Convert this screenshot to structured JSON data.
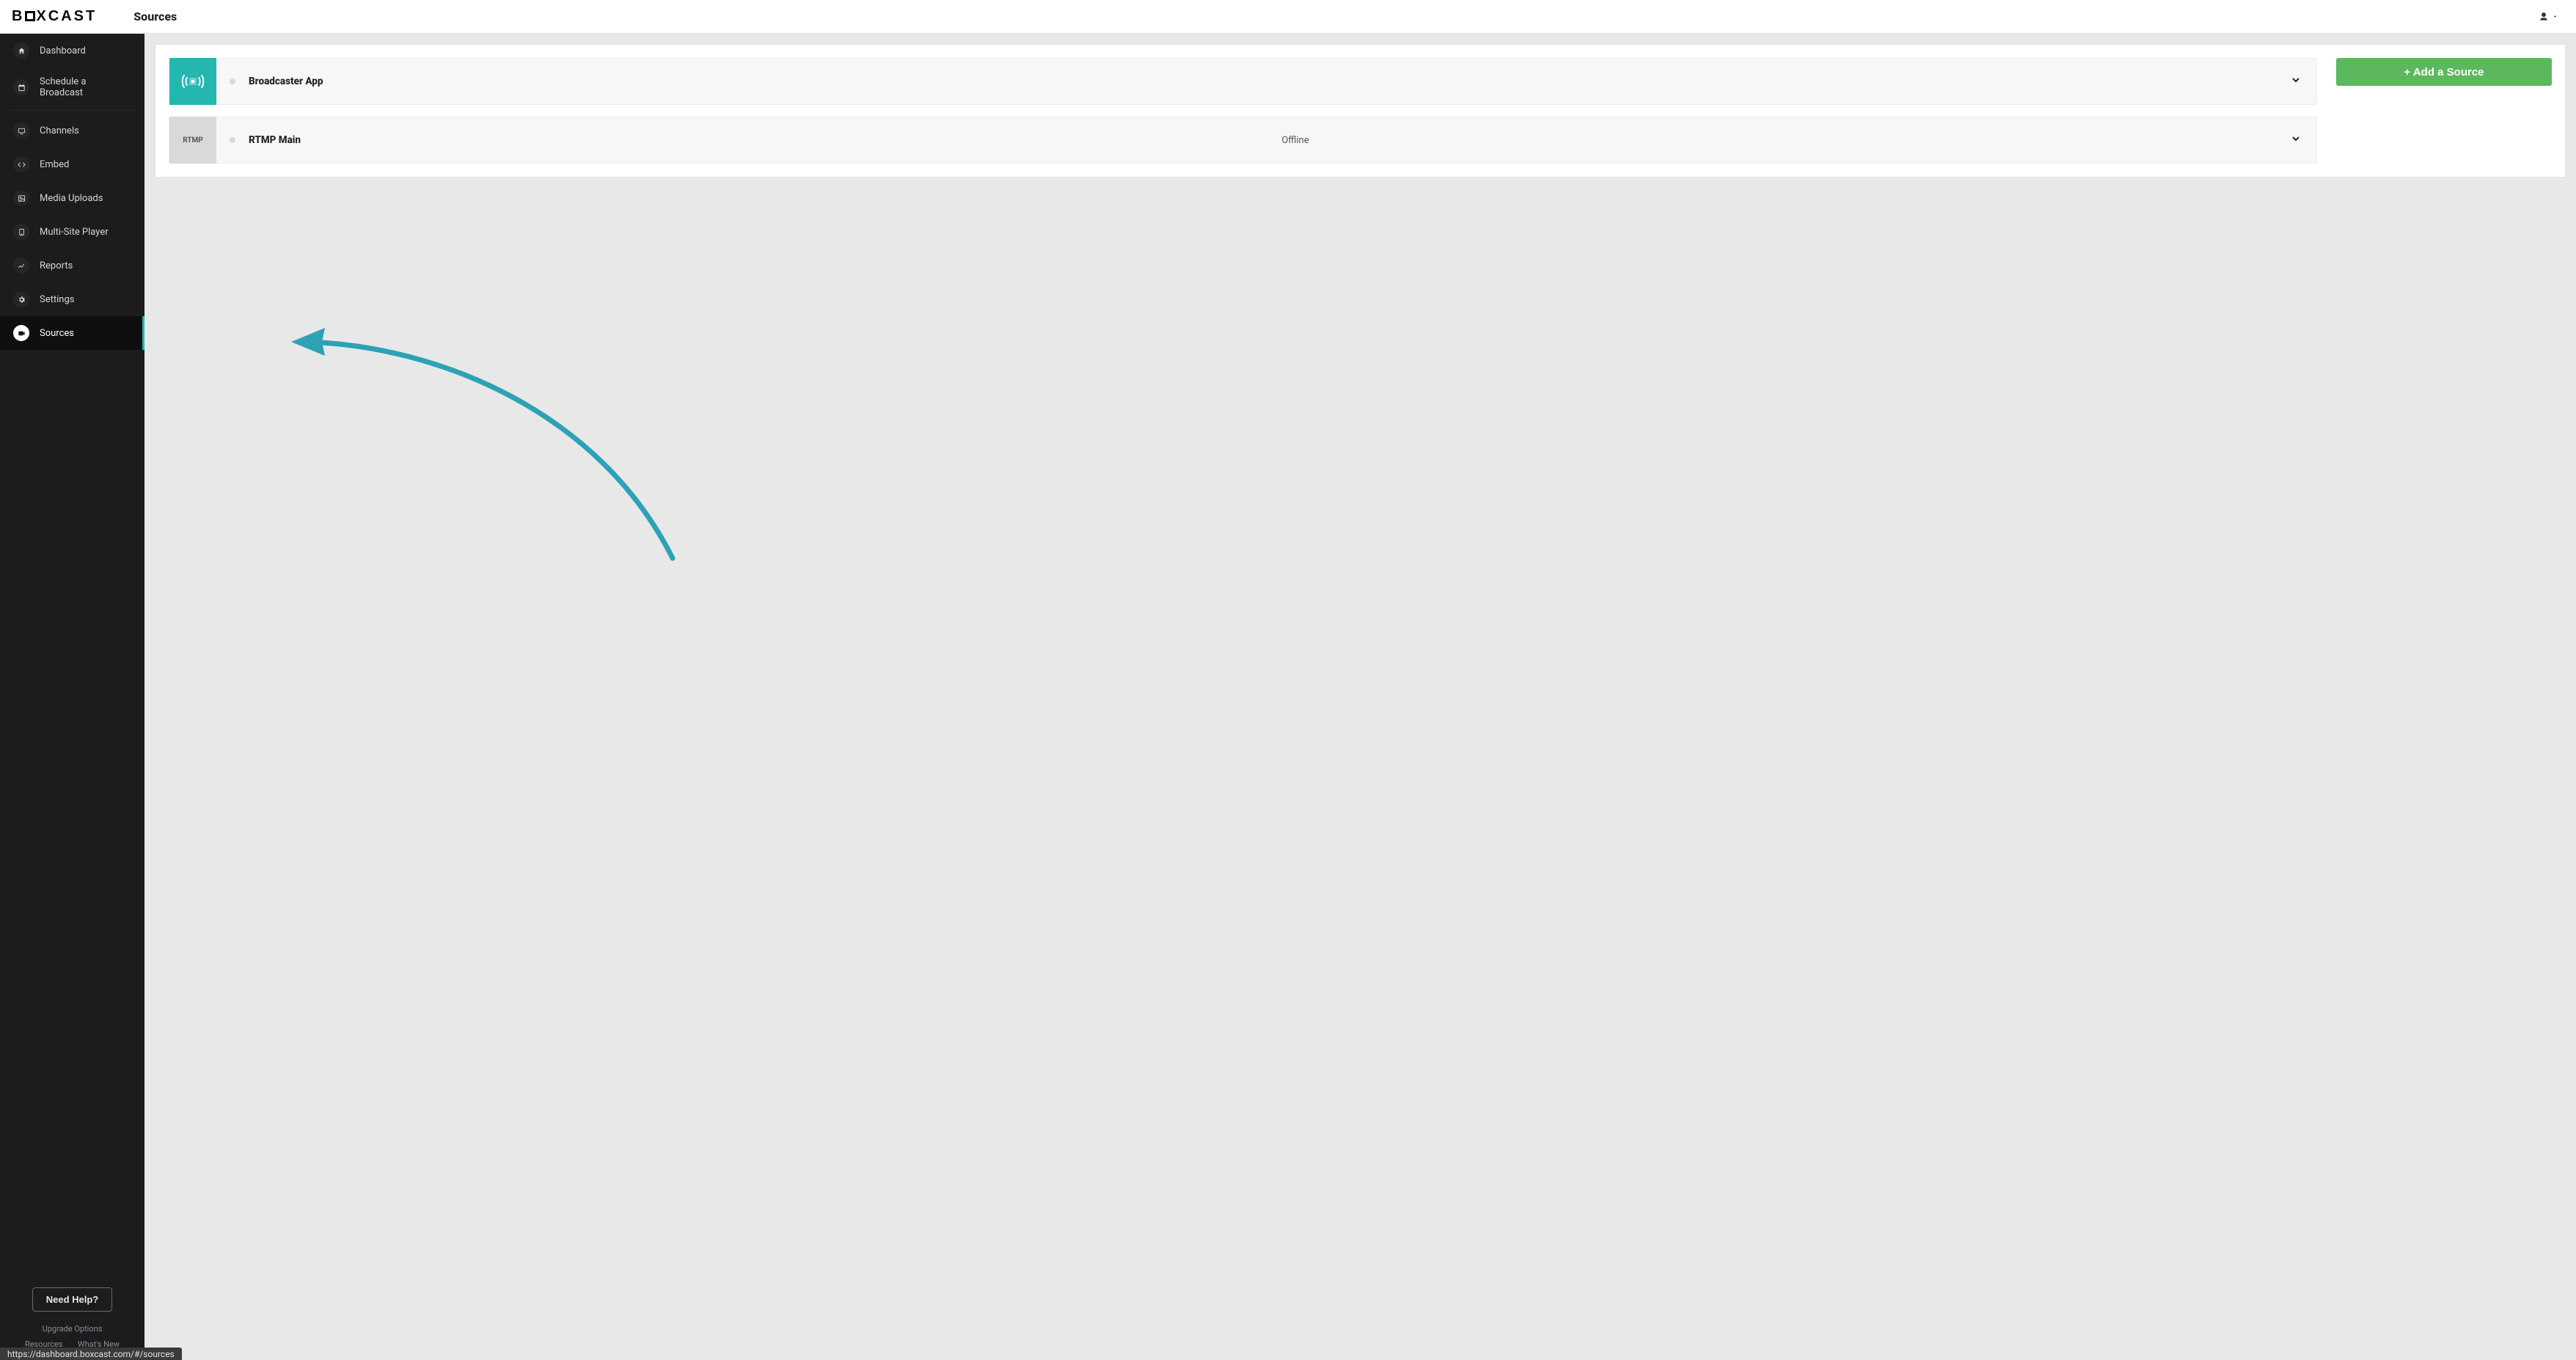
{
  "brand": {
    "prefix": "B",
    "suffix": "XCAST"
  },
  "page_title": "Sources",
  "sidebar": {
    "items": [
      {
        "label": "Dashboard",
        "icon": "home"
      },
      {
        "label": "Schedule a Broadcast",
        "icon": "calendar"
      },
      {
        "label": "Channels",
        "icon": "monitor"
      },
      {
        "label": "Embed",
        "icon": "code"
      },
      {
        "label": "Media Uploads",
        "icon": "image"
      },
      {
        "label": "Multi-Site Player",
        "icon": "tablet"
      },
      {
        "label": "Reports",
        "icon": "chart"
      },
      {
        "label": "Settings",
        "icon": "gear"
      },
      {
        "label": "Sources",
        "icon": "camera"
      }
    ],
    "help_label": "Need Help?",
    "footer": {
      "upgrade": "Upgrade Options",
      "resources": "Resources",
      "whatsnew": "What's New"
    }
  },
  "add_source_label": "+ Add a Source",
  "sources": [
    {
      "name": "Broadcaster App",
      "badge": "",
      "status": "",
      "thumb": "broadcaster"
    },
    {
      "name": "RTMP Main",
      "badge": "RTMP",
      "status": "Offline",
      "thumb": "rtmp"
    }
  ],
  "status_bar_url": "https://dashboard.boxcast.com/#/sources"
}
